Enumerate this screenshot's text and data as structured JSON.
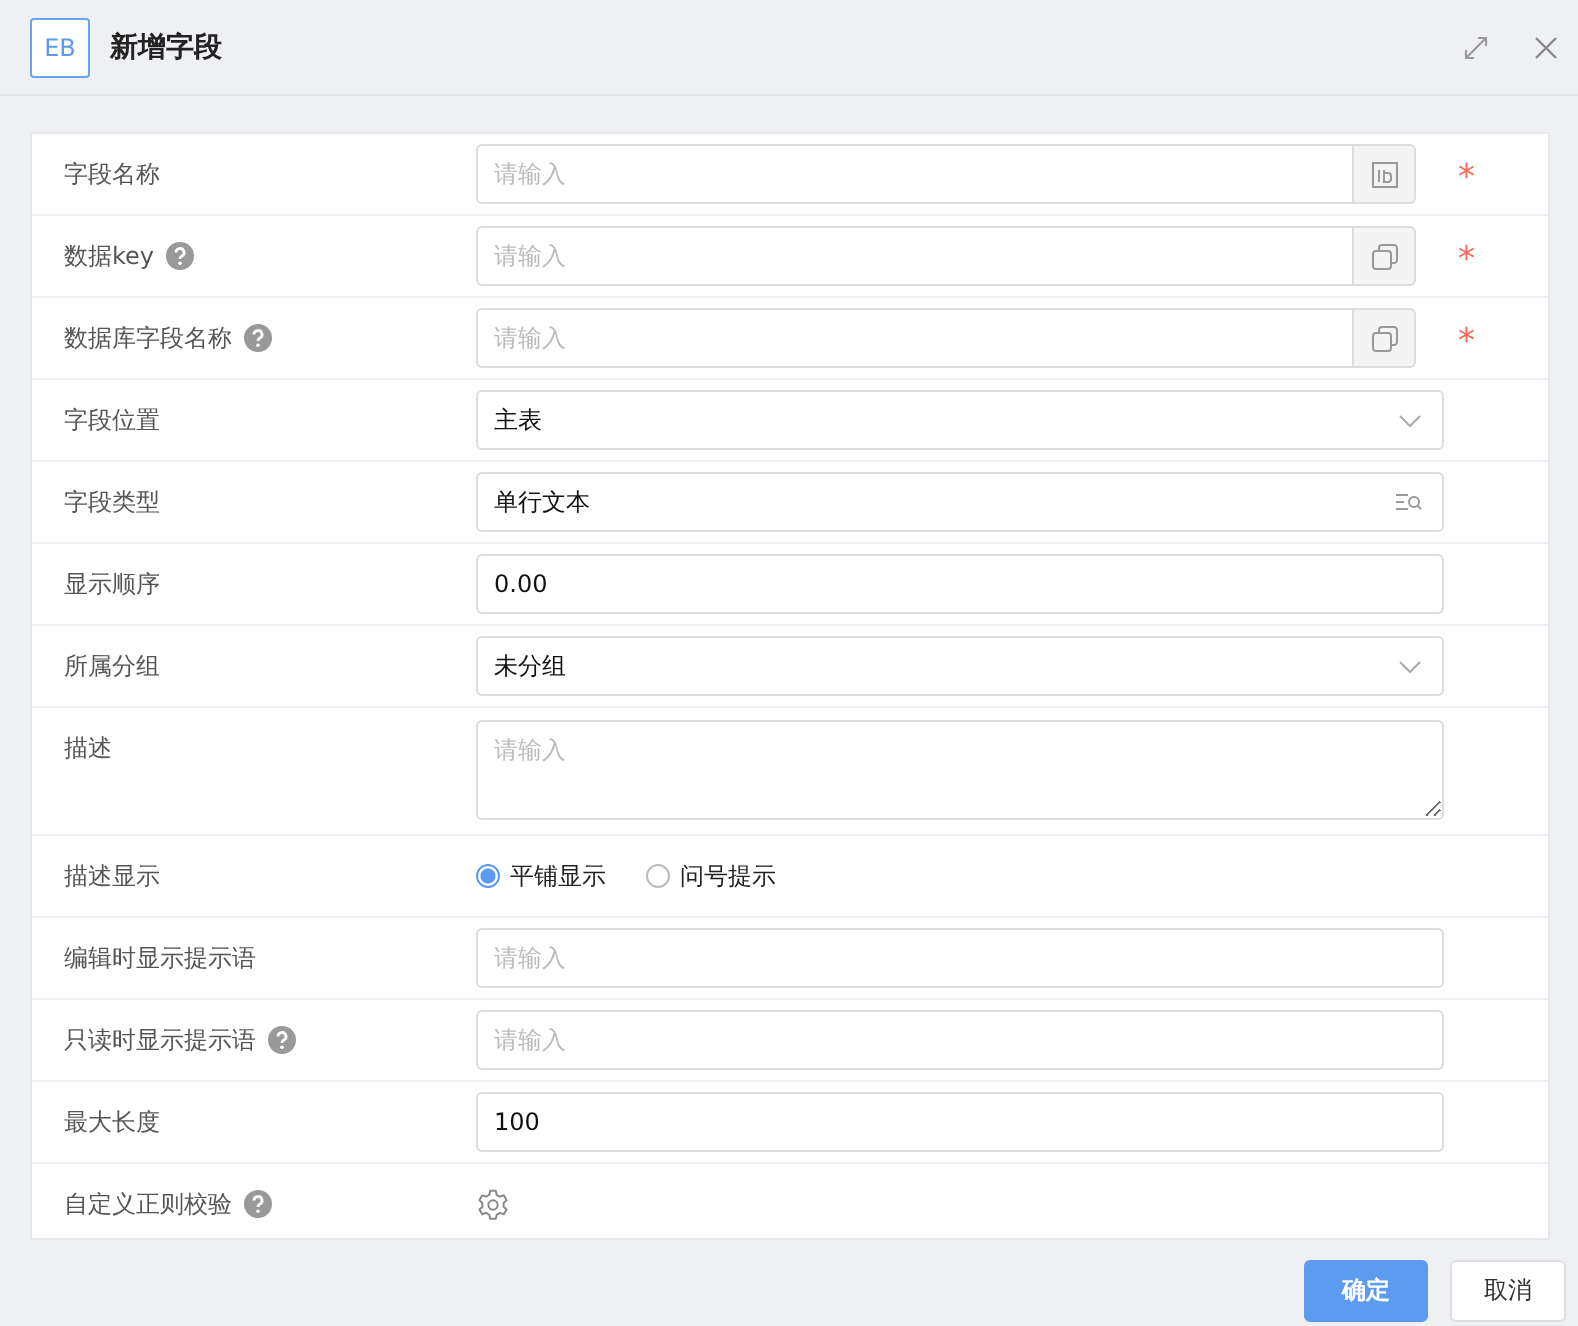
{
  "window": {
    "logo": "EB",
    "title": "新增字段"
  },
  "rows": [
    {
      "label": "字段名称",
      "kind": "input",
      "placeholder": "请输入",
      "addon": {
        "kind": "id"
      },
      "required_mark": "*"
    },
    {
      "label": "数据key",
      "help": true,
      "kind": "input",
      "placeholder": "请输入",
      "addon": {
        "kind": "copy"
      },
      "required_mark": "*"
    },
    {
      "label": "数据库字段名称",
      "help": true,
      "kind": "input",
      "placeholder": "请输入",
      "addon": {
        "kind": "copy"
      },
      "required_mark": "*"
    },
    {
      "label": "字段位置",
      "kind": "select",
      "value": "主表"
    },
    {
      "label": "字段类型",
      "kind": "search-select",
      "value": "单行文本"
    },
    {
      "label": "显示顺序",
      "kind": "input",
      "value": "0.00"
    },
    {
      "label": "所属分组",
      "kind": "select",
      "value": "未分组"
    },
    {
      "label": "描述",
      "kind": "textarea",
      "placeholder": "请输入"
    },
    {
      "label": "描述显示",
      "kind": "radio",
      "options": [
        {
          "label": "平铺显示",
          "selected": true
        },
        {
          "label": "问号提示",
          "selected": false
        }
      ]
    },
    {
      "label": "编辑时显示提示语",
      "kind": "input",
      "placeholder": "请输入"
    },
    {
      "label": "只读时显示提示语",
      "help": true,
      "kind": "input",
      "placeholder": "请输入"
    },
    {
      "label": "最大长度",
      "kind": "input",
      "value": "100"
    },
    {
      "label": "自定义正则校验",
      "help": true,
      "kind": "gear"
    }
  ],
  "buttons": [
    {
      "label": "确定",
      "primary": true
    },
    {
      "label": "取消",
      "primary": false
    }
  ]
}
